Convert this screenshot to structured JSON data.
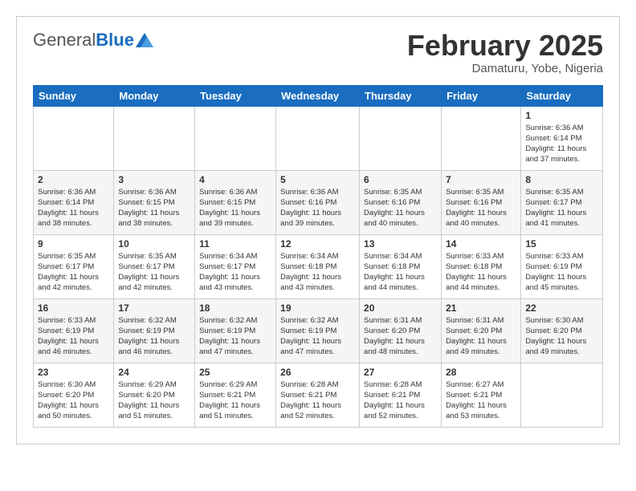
{
  "header": {
    "logo_general": "General",
    "logo_blue": "Blue",
    "title": "February 2025",
    "location": "Damaturu, Yobe, Nigeria"
  },
  "days_of_week": [
    "Sunday",
    "Monday",
    "Tuesday",
    "Wednesday",
    "Thursday",
    "Friday",
    "Saturday"
  ],
  "weeks": [
    [
      {
        "day": "",
        "info": ""
      },
      {
        "day": "",
        "info": ""
      },
      {
        "day": "",
        "info": ""
      },
      {
        "day": "",
        "info": ""
      },
      {
        "day": "",
        "info": ""
      },
      {
        "day": "",
        "info": ""
      },
      {
        "day": "1",
        "info": "Sunrise: 6:36 AM\nSunset: 6:14 PM\nDaylight: 11 hours\nand 37 minutes."
      }
    ],
    [
      {
        "day": "2",
        "info": "Sunrise: 6:36 AM\nSunset: 6:14 PM\nDaylight: 11 hours\nand 38 minutes."
      },
      {
        "day": "3",
        "info": "Sunrise: 6:36 AM\nSunset: 6:15 PM\nDaylight: 11 hours\nand 38 minutes."
      },
      {
        "day": "4",
        "info": "Sunrise: 6:36 AM\nSunset: 6:15 PM\nDaylight: 11 hours\nand 39 minutes."
      },
      {
        "day": "5",
        "info": "Sunrise: 6:36 AM\nSunset: 6:16 PM\nDaylight: 11 hours\nand 39 minutes."
      },
      {
        "day": "6",
        "info": "Sunrise: 6:35 AM\nSunset: 6:16 PM\nDaylight: 11 hours\nand 40 minutes."
      },
      {
        "day": "7",
        "info": "Sunrise: 6:35 AM\nSunset: 6:16 PM\nDaylight: 11 hours\nand 40 minutes."
      },
      {
        "day": "8",
        "info": "Sunrise: 6:35 AM\nSunset: 6:17 PM\nDaylight: 11 hours\nand 41 minutes."
      }
    ],
    [
      {
        "day": "9",
        "info": "Sunrise: 6:35 AM\nSunset: 6:17 PM\nDaylight: 11 hours\nand 42 minutes."
      },
      {
        "day": "10",
        "info": "Sunrise: 6:35 AM\nSunset: 6:17 PM\nDaylight: 11 hours\nand 42 minutes."
      },
      {
        "day": "11",
        "info": "Sunrise: 6:34 AM\nSunset: 6:17 PM\nDaylight: 11 hours\nand 43 minutes."
      },
      {
        "day": "12",
        "info": "Sunrise: 6:34 AM\nSunset: 6:18 PM\nDaylight: 11 hours\nand 43 minutes."
      },
      {
        "day": "13",
        "info": "Sunrise: 6:34 AM\nSunset: 6:18 PM\nDaylight: 11 hours\nand 44 minutes."
      },
      {
        "day": "14",
        "info": "Sunrise: 6:33 AM\nSunset: 6:18 PM\nDaylight: 11 hours\nand 44 minutes."
      },
      {
        "day": "15",
        "info": "Sunrise: 6:33 AM\nSunset: 6:19 PM\nDaylight: 11 hours\nand 45 minutes."
      }
    ],
    [
      {
        "day": "16",
        "info": "Sunrise: 6:33 AM\nSunset: 6:19 PM\nDaylight: 11 hours\nand 46 minutes."
      },
      {
        "day": "17",
        "info": "Sunrise: 6:32 AM\nSunset: 6:19 PM\nDaylight: 11 hours\nand 46 minutes."
      },
      {
        "day": "18",
        "info": "Sunrise: 6:32 AM\nSunset: 6:19 PM\nDaylight: 11 hours\nand 47 minutes."
      },
      {
        "day": "19",
        "info": "Sunrise: 6:32 AM\nSunset: 6:19 PM\nDaylight: 11 hours\nand 47 minutes."
      },
      {
        "day": "20",
        "info": "Sunrise: 6:31 AM\nSunset: 6:20 PM\nDaylight: 11 hours\nand 48 minutes."
      },
      {
        "day": "21",
        "info": "Sunrise: 6:31 AM\nSunset: 6:20 PM\nDaylight: 11 hours\nand 49 minutes."
      },
      {
        "day": "22",
        "info": "Sunrise: 6:30 AM\nSunset: 6:20 PM\nDaylight: 11 hours\nand 49 minutes."
      }
    ],
    [
      {
        "day": "23",
        "info": "Sunrise: 6:30 AM\nSunset: 6:20 PM\nDaylight: 11 hours\nand 50 minutes."
      },
      {
        "day": "24",
        "info": "Sunrise: 6:29 AM\nSunset: 6:20 PM\nDaylight: 11 hours\nand 51 minutes."
      },
      {
        "day": "25",
        "info": "Sunrise: 6:29 AM\nSunset: 6:21 PM\nDaylight: 11 hours\nand 51 minutes."
      },
      {
        "day": "26",
        "info": "Sunrise: 6:28 AM\nSunset: 6:21 PM\nDaylight: 11 hours\nand 52 minutes."
      },
      {
        "day": "27",
        "info": "Sunrise: 6:28 AM\nSunset: 6:21 PM\nDaylight: 11 hours\nand 52 minutes."
      },
      {
        "day": "28",
        "info": "Sunrise: 6:27 AM\nSunset: 6:21 PM\nDaylight: 11 hours\nand 53 minutes."
      },
      {
        "day": "",
        "info": ""
      }
    ]
  ]
}
